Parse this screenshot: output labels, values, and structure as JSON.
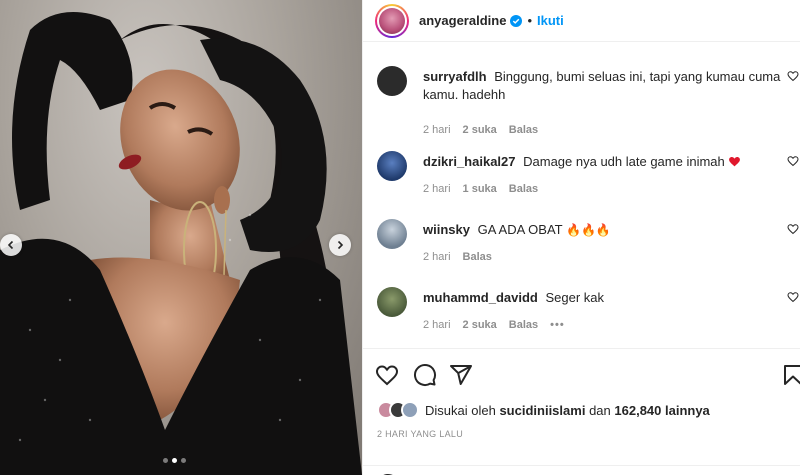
{
  "post": {
    "username": "anyageraldine",
    "follow_label": "Ikuti",
    "separator": "•",
    "carousel": {
      "total": 3,
      "active": 2
    }
  },
  "comments": [
    {
      "user": "surryafdlh",
      "text": "Binggung, bumi seluas ini, tapi yang kumau cuma kamu. hadehh",
      "time": "2 hari",
      "likes": "2 suka",
      "reply": "Balas",
      "avatar_color": "#2b2b2b"
    },
    {
      "user": "dzikri_haikal27",
      "text": "Damage nya udh late game inimah",
      "time": "2 hari",
      "likes": "1 suka",
      "reply": "Balas",
      "avatar_color": "#1f3a6b"
    },
    {
      "user": "wiinsky",
      "text": "GA ADA OBAT",
      "time": "2 hari",
      "likes": "",
      "reply": "Balas",
      "avatar_color": "#6e7f91"
    },
    {
      "user": "muhammd_davidd",
      "text": "Seger kak",
      "time": "2 hari",
      "likes": "2 suka",
      "reply": "Balas",
      "more": "•••",
      "avatar_color": "#4a5a3a"
    }
  ],
  "engagement": {
    "liked_prefix": "Disukai oleh",
    "liked_user": "sucidiniislami",
    "liked_middle": "dan",
    "liked_count": "162,840 lainnya",
    "date": "2 HARI YANG LALU"
  },
  "colors": {
    "accent": "#0095f6",
    "text": "#262626",
    "muted": "#8e8e8e",
    "heart": "#ed4956"
  },
  "icons": [
    "verified-badge-icon",
    "heart-icon",
    "comment-icon",
    "share-icon",
    "bookmark-icon",
    "chevron-left-icon",
    "chevron-right-icon",
    "fire-emoji-icon"
  ]
}
